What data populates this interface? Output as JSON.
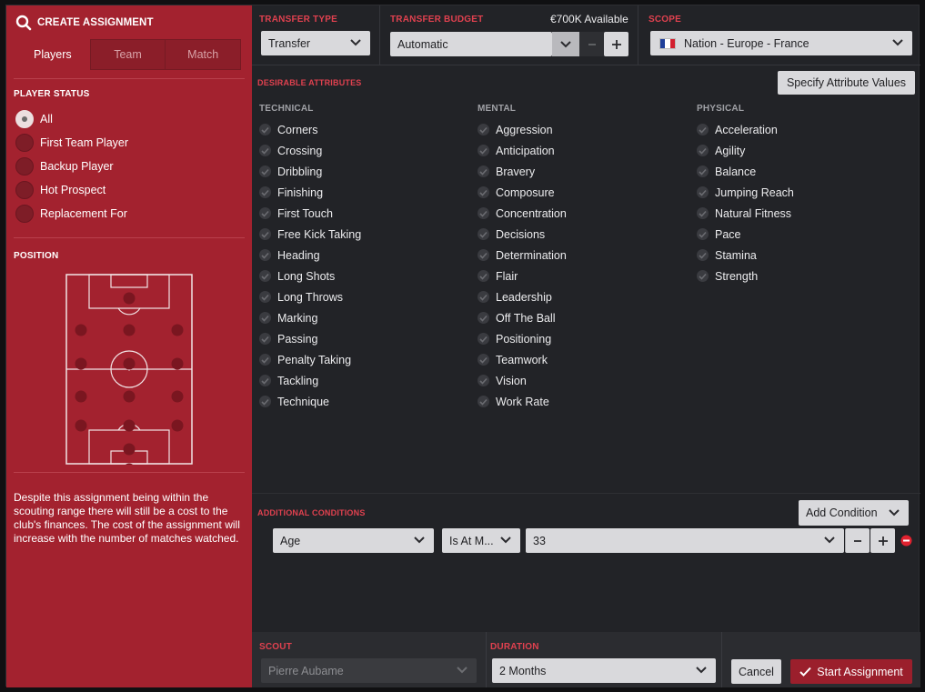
{
  "header": {
    "title": "CREATE ASSIGNMENT"
  },
  "tabs": [
    {
      "label": "Players",
      "active": true
    },
    {
      "label": "Team",
      "active": false
    },
    {
      "label": "Match",
      "active": false
    }
  ],
  "player_status": {
    "label": "PLAYER STATUS",
    "options": [
      {
        "label": "All",
        "selected": true
      },
      {
        "label": "First Team Player",
        "selected": false
      },
      {
        "label": "Backup Player",
        "selected": false
      },
      {
        "label": "Hot Prospect",
        "selected": false
      },
      {
        "label": "Replacement For",
        "selected": false
      }
    ]
  },
  "position": {
    "label": "POSITION"
  },
  "note": "Despite this assignment being within the scouting range there will still be a cost to the club's finances. The cost of the assignment will increase with the number of matches watched.",
  "transfer_type": {
    "label": "TRANSFER TYPE",
    "value": "Transfer"
  },
  "transfer_budget": {
    "label": "TRANSFER BUDGET",
    "available": "€700K Available",
    "value": "Automatic"
  },
  "scope": {
    "label": "SCOPE",
    "value": "Nation - Europe - France"
  },
  "desirable": {
    "label": "DESIRABLE ATTRIBUTES",
    "specify_button": "Specify Attribute Values",
    "technical": {
      "label": "TECHNICAL",
      "items": [
        "Corners",
        "Crossing",
        "Dribbling",
        "Finishing",
        "First Touch",
        "Free Kick Taking",
        "Heading",
        "Long Shots",
        "Long Throws",
        "Marking",
        "Passing",
        "Penalty Taking",
        "Tackling",
        "Technique"
      ]
    },
    "mental": {
      "label": "MENTAL",
      "items": [
        "Aggression",
        "Anticipation",
        "Bravery",
        "Composure",
        "Concentration",
        "Decisions",
        "Determination",
        "Flair",
        "Leadership",
        "Off The Ball",
        "Positioning",
        "Teamwork",
        "Vision",
        "Work Rate"
      ]
    },
    "physical": {
      "label": "PHYSICAL",
      "items": [
        "Acceleration",
        "Agility",
        "Balance",
        "Jumping Reach",
        "Natural Fitness",
        "Pace",
        "Stamina",
        "Strength"
      ]
    }
  },
  "conditions": {
    "label": "ADDITIONAL CONDITIONS",
    "add_button": "Add Condition",
    "row": {
      "field": "Age",
      "operator": "Is At M...",
      "value": "33"
    }
  },
  "scout": {
    "label": "SCOUT",
    "value": "Pierre Aubame"
  },
  "duration": {
    "label": "DURATION",
    "value": "2 Months"
  },
  "actions": {
    "cancel": "Cancel",
    "start": "Start Assignment"
  },
  "colors": {
    "panel_red": "#a3222f",
    "accent_red": "#e0414f",
    "start_button": "#9b1f2c"
  }
}
